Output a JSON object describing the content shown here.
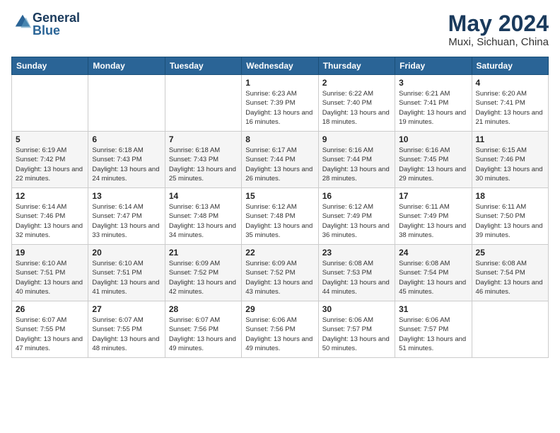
{
  "logo": {
    "text_general": "General",
    "text_blue": "Blue"
  },
  "title": "May 2024",
  "location": "Muxi, Sichuan, China",
  "weekdays": [
    "Sunday",
    "Monday",
    "Tuesday",
    "Wednesday",
    "Thursday",
    "Friday",
    "Saturday"
  ],
  "weeks": [
    [
      {
        "day": "",
        "content": ""
      },
      {
        "day": "",
        "content": ""
      },
      {
        "day": "",
        "content": ""
      },
      {
        "day": "1",
        "content": "Sunrise: 6:23 AM\nSunset: 7:39 PM\nDaylight: 13 hours and 16 minutes."
      },
      {
        "day": "2",
        "content": "Sunrise: 6:22 AM\nSunset: 7:40 PM\nDaylight: 13 hours and 18 minutes."
      },
      {
        "day": "3",
        "content": "Sunrise: 6:21 AM\nSunset: 7:41 PM\nDaylight: 13 hours and 19 minutes."
      },
      {
        "day": "4",
        "content": "Sunrise: 6:20 AM\nSunset: 7:41 PM\nDaylight: 13 hours and 21 minutes."
      }
    ],
    [
      {
        "day": "5",
        "content": "Sunrise: 6:19 AM\nSunset: 7:42 PM\nDaylight: 13 hours and 22 minutes."
      },
      {
        "day": "6",
        "content": "Sunrise: 6:18 AM\nSunset: 7:43 PM\nDaylight: 13 hours and 24 minutes."
      },
      {
        "day": "7",
        "content": "Sunrise: 6:18 AM\nSunset: 7:43 PM\nDaylight: 13 hours and 25 minutes."
      },
      {
        "day": "8",
        "content": "Sunrise: 6:17 AM\nSunset: 7:44 PM\nDaylight: 13 hours and 26 minutes."
      },
      {
        "day": "9",
        "content": "Sunrise: 6:16 AM\nSunset: 7:44 PM\nDaylight: 13 hours and 28 minutes."
      },
      {
        "day": "10",
        "content": "Sunrise: 6:16 AM\nSunset: 7:45 PM\nDaylight: 13 hours and 29 minutes."
      },
      {
        "day": "11",
        "content": "Sunrise: 6:15 AM\nSunset: 7:46 PM\nDaylight: 13 hours and 30 minutes."
      }
    ],
    [
      {
        "day": "12",
        "content": "Sunrise: 6:14 AM\nSunset: 7:46 PM\nDaylight: 13 hours and 32 minutes."
      },
      {
        "day": "13",
        "content": "Sunrise: 6:14 AM\nSunset: 7:47 PM\nDaylight: 13 hours and 33 minutes."
      },
      {
        "day": "14",
        "content": "Sunrise: 6:13 AM\nSunset: 7:48 PM\nDaylight: 13 hours and 34 minutes."
      },
      {
        "day": "15",
        "content": "Sunrise: 6:12 AM\nSunset: 7:48 PM\nDaylight: 13 hours and 35 minutes."
      },
      {
        "day": "16",
        "content": "Sunrise: 6:12 AM\nSunset: 7:49 PM\nDaylight: 13 hours and 36 minutes."
      },
      {
        "day": "17",
        "content": "Sunrise: 6:11 AM\nSunset: 7:49 PM\nDaylight: 13 hours and 38 minutes."
      },
      {
        "day": "18",
        "content": "Sunrise: 6:11 AM\nSunset: 7:50 PM\nDaylight: 13 hours and 39 minutes."
      }
    ],
    [
      {
        "day": "19",
        "content": "Sunrise: 6:10 AM\nSunset: 7:51 PM\nDaylight: 13 hours and 40 minutes."
      },
      {
        "day": "20",
        "content": "Sunrise: 6:10 AM\nSunset: 7:51 PM\nDaylight: 13 hours and 41 minutes."
      },
      {
        "day": "21",
        "content": "Sunrise: 6:09 AM\nSunset: 7:52 PM\nDaylight: 13 hours and 42 minutes."
      },
      {
        "day": "22",
        "content": "Sunrise: 6:09 AM\nSunset: 7:52 PM\nDaylight: 13 hours and 43 minutes."
      },
      {
        "day": "23",
        "content": "Sunrise: 6:08 AM\nSunset: 7:53 PM\nDaylight: 13 hours and 44 minutes."
      },
      {
        "day": "24",
        "content": "Sunrise: 6:08 AM\nSunset: 7:54 PM\nDaylight: 13 hours and 45 minutes."
      },
      {
        "day": "25",
        "content": "Sunrise: 6:08 AM\nSunset: 7:54 PM\nDaylight: 13 hours and 46 minutes."
      }
    ],
    [
      {
        "day": "26",
        "content": "Sunrise: 6:07 AM\nSunset: 7:55 PM\nDaylight: 13 hours and 47 minutes."
      },
      {
        "day": "27",
        "content": "Sunrise: 6:07 AM\nSunset: 7:55 PM\nDaylight: 13 hours and 48 minutes."
      },
      {
        "day": "28",
        "content": "Sunrise: 6:07 AM\nSunset: 7:56 PM\nDaylight: 13 hours and 49 minutes."
      },
      {
        "day": "29",
        "content": "Sunrise: 6:06 AM\nSunset: 7:56 PM\nDaylight: 13 hours and 49 minutes."
      },
      {
        "day": "30",
        "content": "Sunrise: 6:06 AM\nSunset: 7:57 PM\nDaylight: 13 hours and 50 minutes."
      },
      {
        "day": "31",
        "content": "Sunrise: 6:06 AM\nSunset: 7:57 PM\nDaylight: 13 hours and 51 minutes."
      },
      {
        "day": "",
        "content": ""
      }
    ]
  ]
}
